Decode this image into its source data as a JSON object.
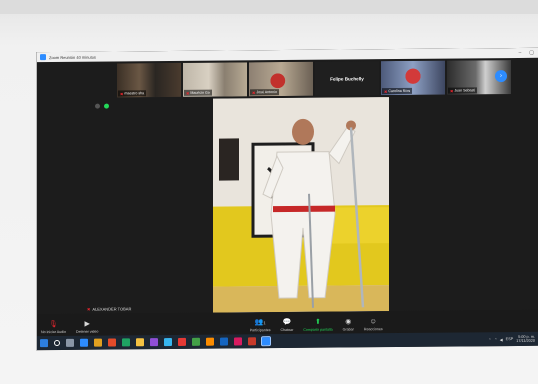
{
  "window": {
    "title": "Zoom Reunión 40 minutos",
    "controls": [
      "–",
      "▢"
    ]
  },
  "gallery": {
    "participants": [
      {
        "name": "maestro sha",
        "muted": true
      },
      {
        "name": "Mauricio Go",
        "muted": true
      },
      {
        "name": "José Antonio",
        "muted": true
      },
      {
        "name": "Felipe Buchelly",
        "muted": false,
        "text_only": true
      },
      {
        "name": "Carolina Ríos",
        "muted": true
      },
      {
        "name": "Juan Sebasti",
        "muted": true
      }
    ],
    "next_icon": "chevron-right-icon",
    "next_glyph": "›"
  },
  "self_view": {
    "name": "ALEXANDER TOBAR"
  },
  "toolbar": {
    "items": [
      {
        "label": "No iniciar Audio",
        "icon": "mic-muted-icon",
        "glyph": "🎙",
        "state": "red"
      },
      {
        "label": "Detener video",
        "icon": "video-camera-icon",
        "glyph": "▶",
        "state": "normal"
      },
      {
        "label": "Participantes",
        "icon": "participants-icon",
        "glyph": "👥",
        "state": "normal"
      },
      {
        "label": "Chatear",
        "icon": "chat-icon",
        "glyph": "💬",
        "state": "normal"
      },
      {
        "label": "Compartir pantalla",
        "icon": "share-screen-icon",
        "glyph": "⬆",
        "state": "green"
      },
      {
        "label": "Grabar",
        "icon": "record-icon",
        "glyph": "◉",
        "state": "normal"
      },
      {
        "label": "Reacciones",
        "icon": "reactions-icon",
        "glyph": "☺",
        "state": "normal"
      }
    ],
    "participants_count": "1"
  },
  "taskbar": {
    "icon_colors": [
      "#2d7fe0",
      "#ffffff",
      "#e0a020",
      "#e34b2a",
      "#2d8cff",
      "#1fa463",
      "#c73a2a",
      "#f5c242",
      "#8f4fd6",
      "#37b6f0",
      "#e53935",
      "#43a047",
      "#fb8c00",
      "#1565c0",
      "#d81b60"
    ],
    "tray_lang": "ESP",
    "time": "5:00 p. m.",
    "date": "17/11/2020"
  },
  "colors": {
    "zoom_blue": "#2d8cff",
    "mute_red": "#e5262e",
    "share_green": "#23d959"
  }
}
